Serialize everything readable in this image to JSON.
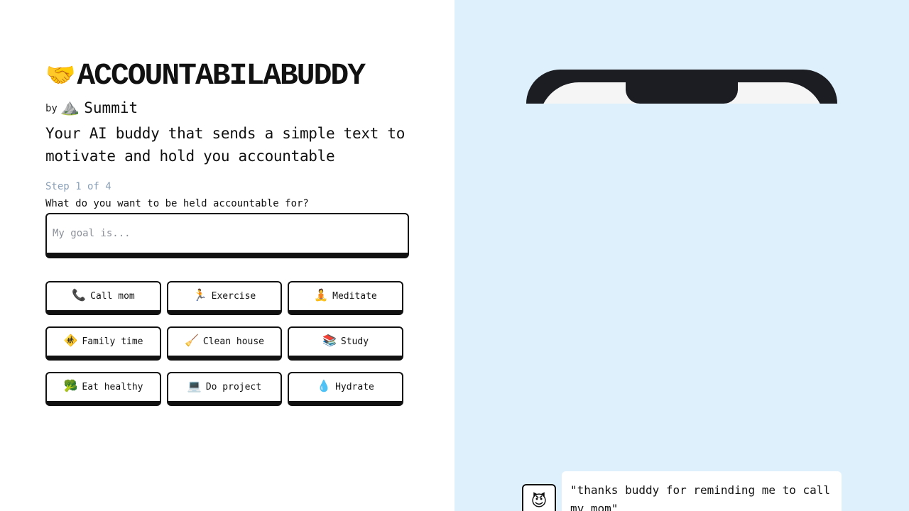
{
  "header": {
    "title_emoji": "🤝",
    "title": "ACCOUNTABILABUDDY",
    "by_label": "by",
    "brand_logo": "⛰️",
    "brand_name": "Summit",
    "tagline": "Your AI buddy that sends a simple text to motivate and hold you accountable"
  },
  "form": {
    "step_label": "Step 1 of 4",
    "question": "What do you want to be held accountable for?",
    "goal_placeholder": "My goal is...",
    "goal_value": ""
  },
  "suggestions": [
    {
      "icon": "📞",
      "icon_name": "phone-icon",
      "label": "Call mom"
    },
    {
      "icon": "🏃",
      "icon_name": "runner-icon",
      "label": "Exercise"
    },
    {
      "icon": "🧘",
      "icon_name": "meditation-icon",
      "label": "Meditate"
    },
    {
      "icon": "🚸",
      "icon_name": "family-icon",
      "label": "Family time"
    },
    {
      "icon": "🧹",
      "icon_name": "broom-icon",
      "label": "Clean house"
    },
    {
      "icon": "📚",
      "icon_name": "books-icon",
      "label": "Study"
    },
    {
      "icon": "🥦",
      "icon_name": "broccoli-icon",
      "label": "Eat healthy"
    },
    {
      "icon": "💻",
      "icon_name": "laptop-icon",
      "label": "Do project"
    },
    {
      "icon": "💧",
      "icon_name": "droplet-icon",
      "label": "Hydrate"
    }
  ],
  "testimonial": {
    "avatar": "😈",
    "avatar_name": "devil-avatar-icon",
    "message": "\"thanks buddy for reminding me to call my mom\""
  },
  "colors": {
    "right_panel_bg": "#dff0fd",
    "step_text": "#8aa0b8",
    "border": "#111111",
    "phone_frame": "#1b1d22"
  }
}
